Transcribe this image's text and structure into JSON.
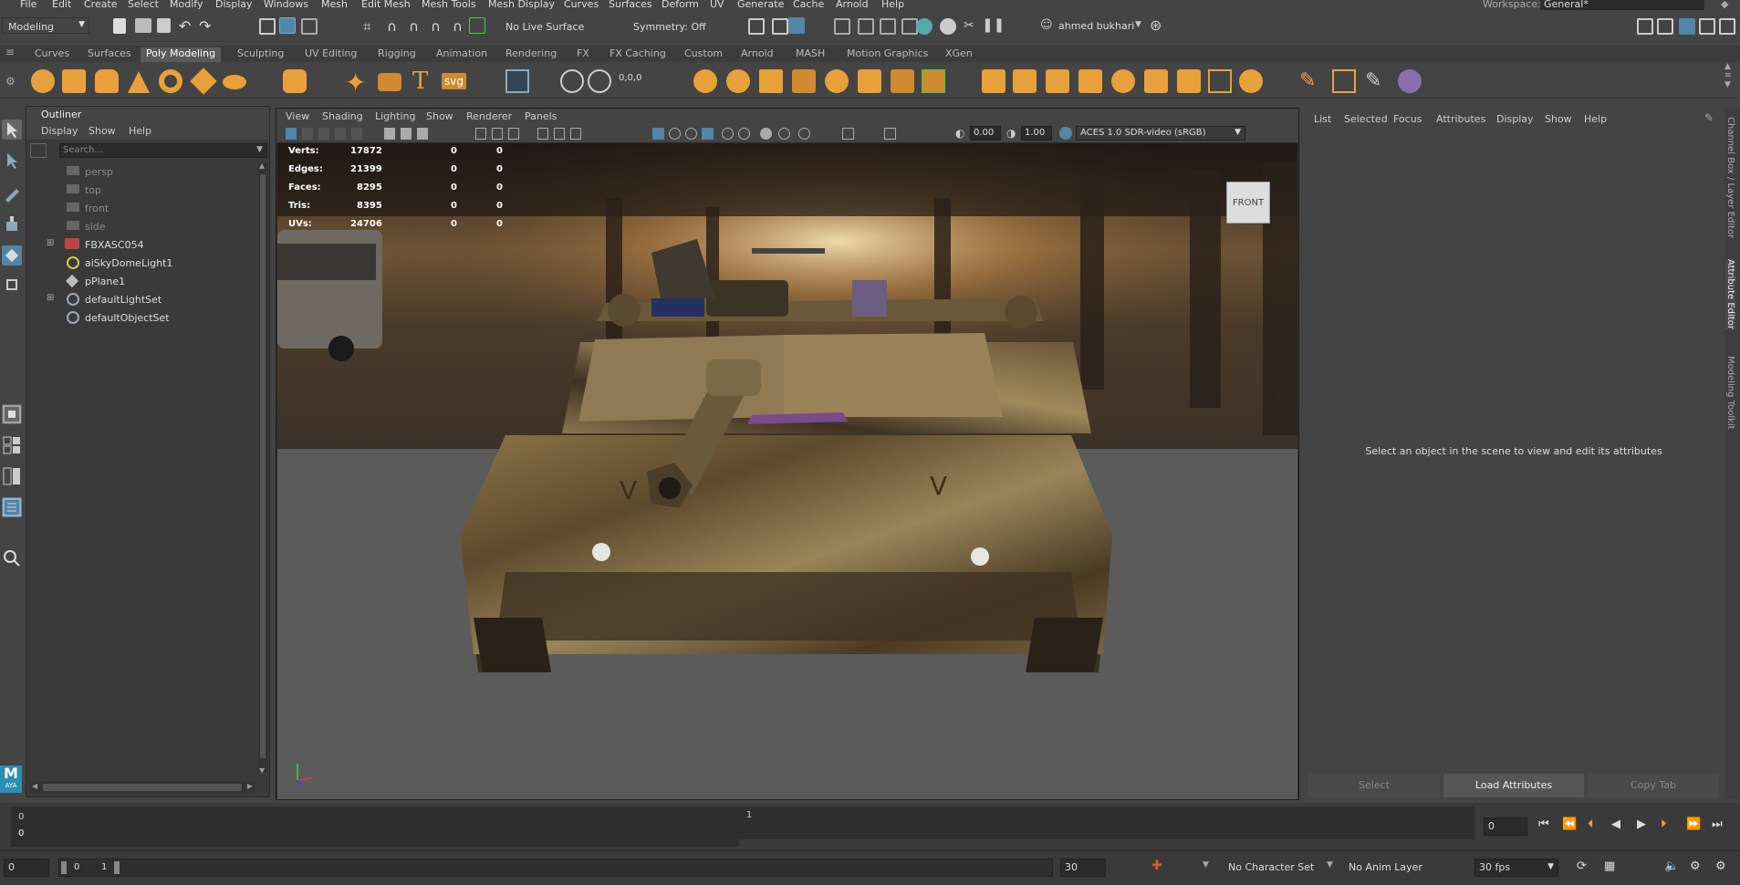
{
  "menubar": {
    "items": [
      "File",
      "Edit",
      "Create",
      "Select",
      "Modify",
      "Display",
      "Windows",
      "Mesh",
      "Edit Mesh",
      "Mesh Tools",
      "Mesh Display",
      "Curves",
      "Surfaces",
      "Deform",
      "UV",
      "Generate",
      "Cache",
      "Arnold",
      "Help"
    ],
    "workspace_label": "Workspace:",
    "workspace_value": "General*"
  },
  "statusline": {
    "mode": "Modeling",
    "live_surface": "No Live Surface",
    "symmetry": "Symmetry: Off",
    "user": "ahmed bukhari"
  },
  "shelf": {
    "tabs": [
      "Curves",
      "Surfaces",
      "Poly Modeling",
      "Sculpting",
      "UV Editing",
      "Rigging",
      "Animation",
      "Rendering",
      "FX",
      "FX Caching",
      "Custom",
      "Arnold",
      "MASH",
      "Motion Graphics",
      "XGen"
    ],
    "active_tab": "Poly Modeling",
    "svg_label": "svg",
    "t_label": "T"
  },
  "outliner": {
    "title": "Outliner",
    "menu": [
      "Display",
      "Show",
      "Help"
    ],
    "search_placeholder": "Search...",
    "items": [
      {
        "label": "persp",
        "icon": "camera-icon",
        "dim": true,
        "expand": false
      },
      {
        "label": "top",
        "icon": "camera-icon",
        "dim": true,
        "expand": false
      },
      {
        "label": "front",
        "icon": "camera-icon",
        "dim": true,
        "expand": false
      },
      {
        "label": "side",
        "icon": "camera-icon",
        "dim": true,
        "expand": false
      },
      {
        "label": "FBXASC054",
        "icon": "fbx-group-icon",
        "dim": false,
        "expand": true
      },
      {
        "label": "aiSkyDomeLight1",
        "icon": "skydome-light-icon",
        "dim": false,
        "expand": false
      },
      {
        "label": "pPlane1",
        "icon": "poly-plane-icon",
        "dim": false,
        "expand": false
      },
      {
        "label": "defaultLightSet",
        "icon": "set-icon",
        "dim": false,
        "expand": true
      },
      {
        "label": "defaultObjectSet",
        "icon": "set-icon",
        "dim": false,
        "expand": false
      }
    ]
  },
  "viewport": {
    "menu": [
      "View",
      "Shading",
      "Lighting",
      "Show",
      "Renderer",
      "Panels"
    ],
    "exposure": "0.00",
    "gamma": "1.00",
    "color_space": "ACES 1.0 SDR-video (sRGB)",
    "cube_label": "FRONT",
    "hud": [
      {
        "label": "Verts:",
        "v1": "17872",
        "v2": "0",
        "v3": "0"
      },
      {
        "label": "Edges:",
        "v1": "21399",
        "v2": "0",
        "v3": "0"
      },
      {
        "label": "Faces:",
        "v1": "8295",
        "v2": "0",
        "v3": "0"
      },
      {
        "label": "Tris:",
        "v1": "8395",
        "v2": "0",
        "v3": "0"
      },
      {
        "label": "UVs:",
        "v1": "24706",
        "v2": "0",
        "v3": "0"
      }
    ]
  },
  "attribute_editor": {
    "menu": [
      "List",
      "Selected",
      "Focus",
      "Attributes",
      "Display",
      "Show",
      "Help"
    ],
    "message": "Select an object in the scene to view and edit its attributes",
    "select_btn": "Select",
    "load_btn": "Load Attributes",
    "copy_btn": "Copy Tab"
  },
  "side_tabs": [
    "Channel Box / Layer Editor",
    "Attribute Editor",
    "Modeling Toolkit"
  ],
  "timeline": {
    "start_top": "0",
    "start_field": "0",
    "tick_1": "1",
    "current_frame": "0"
  },
  "range": {
    "start": "0",
    "inner_start": "0",
    "inner_mark": "1",
    "end": "30",
    "character_set": "No Character Set",
    "anim_layer": "No Anim Layer",
    "fps": "30 fps"
  },
  "logo_text": "M",
  "logo_sub": "AYA",
  "colors": {
    "accent_blue": "#5285a6",
    "shelf_orange": "#e8a13a",
    "viewport_floor": "#5b5b5b"
  }
}
